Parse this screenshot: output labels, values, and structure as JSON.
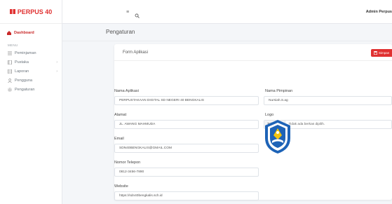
{
  "app": {
    "brand": "PERPUS 40"
  },
  "sidebar": {
    "dashboard_label": "Dashboard",
    "section_label": "MENU",
    "items": [
      {
        "label": "Peminjaman",
        "icon": "list-icon",
        "has_children": false
      },
      {
        "label": "Pustaka",
        "icon": "book-icon",
        "has_children": true
      },
      {
        "label": "Laporan",
        "icon": "report-icon",
        "has_children": true
      },
      {
        "label": "Pengguna",
        "icon": "users-icon",
        "has_children": false
      },
      {
        "label": "Pengaturan",
        "icon": "gear-icon",
        "has_children": false
      }
    ]
  },
  "topbar": {
    "user": "Admin Perpus"
  },
  "page": {
    "title": "Pengaturan"
  },
  "form": {
    "title": "Form Aplikasi",
    "save_label": "Simpan",
    "fields": {
      "app_name": {
        "label": "Nama Aplikasi",
        "value": "PERPUSTAKAAN DIGITAL SD NEGERI 40 BENGKALIS"
      },
      "leader": {
        "label": "Nama Pimpinan",
        "value": "Nursiah.S.ag"
      },
      "address": {
        "label": "Alamat",
        "value": "JL. AWANG MAHMUDA"
      },
      "logo": {
        "label": "Logo",
        "button": "Telusuri...",
        "status": "Tidak ada berkas dipilih."
      },
      "email": {
        "label": "Email",
        "value": "SDN40BENGKALIS@GMAIL.COM"
      },
      "phone": {
        "label": "Nomor Telepon",
        "value": "0812-3456-7890"
      },
      "website": {
        "label": "Website",
        "value": "https://sdn40bengkalis.sch.id"
      }
    }
  },
  "colors": {
    "accent": "#e03131",
    "logo_blue": "#1d63b7",
    "logo_yellow": "#f2c40e"
  }
}
